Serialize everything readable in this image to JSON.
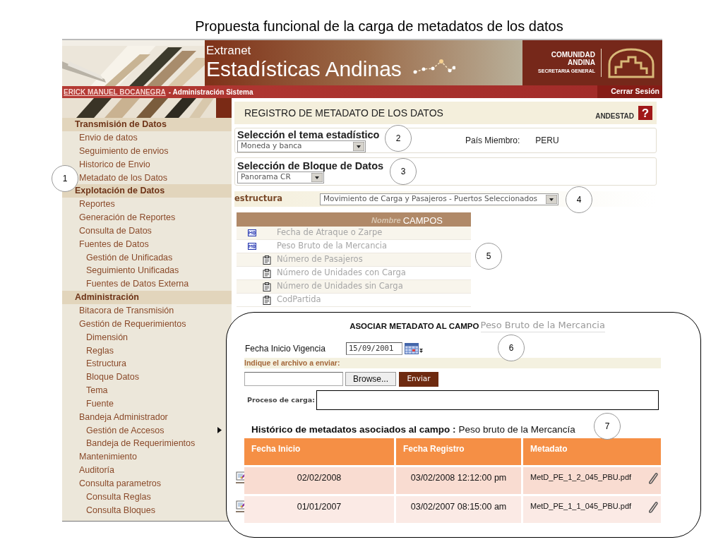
{
  "slide_title": "Propuesta funcional de la carga de metadatos de los datos",
  "header": {
    "product": "Extranet",
    "title": "Estadísticas Andinas",
    "org_line_1": "COMUNIDAD",
    "org_line_2": "ANDINA",
    "org_subtitle": "SECRETARIA GENERAL",
    "user_link": "ERICK MANUEL BOCANEGRA",
    "user_role": "- Administración Sistema",
    "logout": "Cerrar Sesión"
  },
  "sidebar": {
    "sections": [
      {
        "label": "Transmisión de Datos",
        "children": [
          {
            "label": "Envio de datos"
          },
          {
            "label": "Seguimiento de envios"
          },
          {
            "label": "Historico de Envio"
          },
          {
            "label": "Metadato de los Datos"
          }
        ]
      },
      {
        "label": "Explotación de Datos",
        "children": [
          {
            "label": "Reportes"
          },
          {
            "label": "Generación de Reportes"
          },
          {
            "label": "Consulta de Datos"
          },
          {
            "label": "Fuentes de Datos",
            "children": [
              {
                "label": "Gestión de Unificadas"
              },
              {
                "label": "Seguimiento Unificadas"
              },
              {
                "label": "Fuentes de Datos Externa"
              }
            ]
          }
        ]
      },
      {
        "label": "Administración",
        "children": [
          {
            "label": "Bitacora de Transmisión"
          },
          {
            "label": "Gestión de Requerimientos",
            "children": [
              {
                "label": "Dimensión"
              },
              {
                "label": "Reglas"
              },
              {
                "label": "Estructura"
              },
              {
                "label": "Bloque Datos"
              },
              {
                "label": "Tema"
              },
              {
                "label": "Fuente"
              }
            ]
          },
          {
            "label": "Bandeja Administrador",
            "children": [
              {
                "label": "Gestión de Accesos",
                "flyout": true
              },
              {
                "label": "Bandeja de Requerimientos",
                "flyout": false
              }
            ]
          },
          {
            "label": "Mantenimiento"
          },
          {
            "label": "Auditoría"
          },
          {
            "label": "Consulta parametros",
            "children": [
              {
                "label": "Consulta Reglas"
              },
              {
                "label": "Consulta Bloques"
              }
            ]
          }
        ]
      }
    ]
  },
  "main": {
    "page_title": "REGISTRO DE METADATO DE LOS DATOS",
    "module": "ANDESTAD",
    "help": "?",
    "theme": {
      "label": "Selección el tema estadístico",
      "value": "Moneda y banca",
      "country_label": "País Miembro:",
      "country": "PERU"
    },
    "block": {
      "label": "Selección de Bloque de Datos",
      "value": "Panorama CR"
    },
    "structure": {
      "label": "estructura",
      "value": "Movimiento de Carga y Pasajeros - Puertos Seleccionados"
    },
    "fields_table": {
      "header_faded": "Nombre",
      "header": "CAMPOS",
      "rows": [
        {
          "kind": "metadata",
          "label": "Fecha de Atraque o Zarpe"
        },
        {
          "kind": "metadata",
          "label": "Peso Bruto de la Mercancia"
        },
        {
          "kind": "field",
          "label": "Número de Pasajeros"
        },
        {
          "kind": "field",
          "label": "Número de Unidades con Carga"
        },
        {
          "kind": "field",
          "label": "Número de Unidades sin Carga"
        },
        {
          "kind": "field",
          "label": "CodPartida"
        }
      ]
    }
  },
  "dialog": {
    "title": "ASOCIAR METADATO AL CAMPO",
    "field_name": "Peso Bruto de la Mercancia",
    "date_label": "Fecha Inicio Vigencia",
    "date_value": "15/09/2001",
    "file_prompt": "Indique el archivo a enviar:",
    "browse": "Browse...",
    "send": "Enviar",
    "process_label": "Proceso de carga:",
    "history_title": "Histórico de metadatos asociados al campo :",
    "history_field": "Peso bruto de la Mercancía",
    "columns": [
      "Fecha Inicio",
      "Fecha Registro",
      "Metadato"
    ],
    "rows": [
      {
        "start": "02/02/2008",
        "registered": "03/02/2008 12:12:00 pm",
        "file": "MetD_PE_1_2_045_PBU.pdf"
      },
      {
        "start": "01/01/2007",
        "registered": "03/02/2007 08:15:00 am",
        "file": "MetD_PE_1_1_045_PBU.pdf"
      }
    ]
  },
  "callouts": [
    "1",
    "2",
    "3",
    "4",
    "5",
    "6",
    "7"
  ]
}
